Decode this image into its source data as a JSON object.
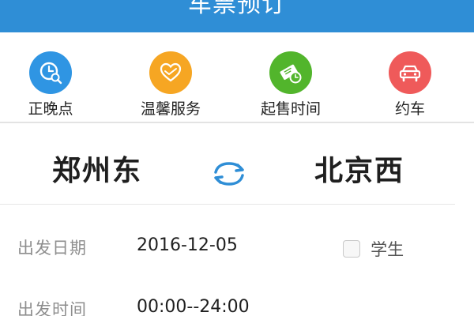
{
  "header": {
    "title": "车票预订"
  },
  "quick_actions": [
    {
      "label": "正晚点",
      "icon": "clock-search-icon",
      "color": "#2f95e3"
    },
    {
      "label": "温馨服务",
      "icon": "heart-hands-icon",
      "color": "#f6a623"
    },
    {
      "label": "起售时间",
      "icon": "ticket-clock-icon",
      "color": "#52b52c"
    },
    {
      "label": "约车",
      "icon": "car-icon",
      "color": "#ef5a5a"
    }
  ],
  "route": {
    "from": "郑州东",
    "to": "北京西",
    "swap_icon": "swap-arrows-icon"
  },
  "form": {
    "date_label": "出发日期",
    "date_value": "2016-12-05",
    "student_label": "学生",
    "student_checked": false,
    "time_label": "出发时间",
    "time_value": "00:00--24:00"
  },
  "colors": {
    "header": "#2f8ed6",
    "accent": "#2f8ed6"
  }
}
